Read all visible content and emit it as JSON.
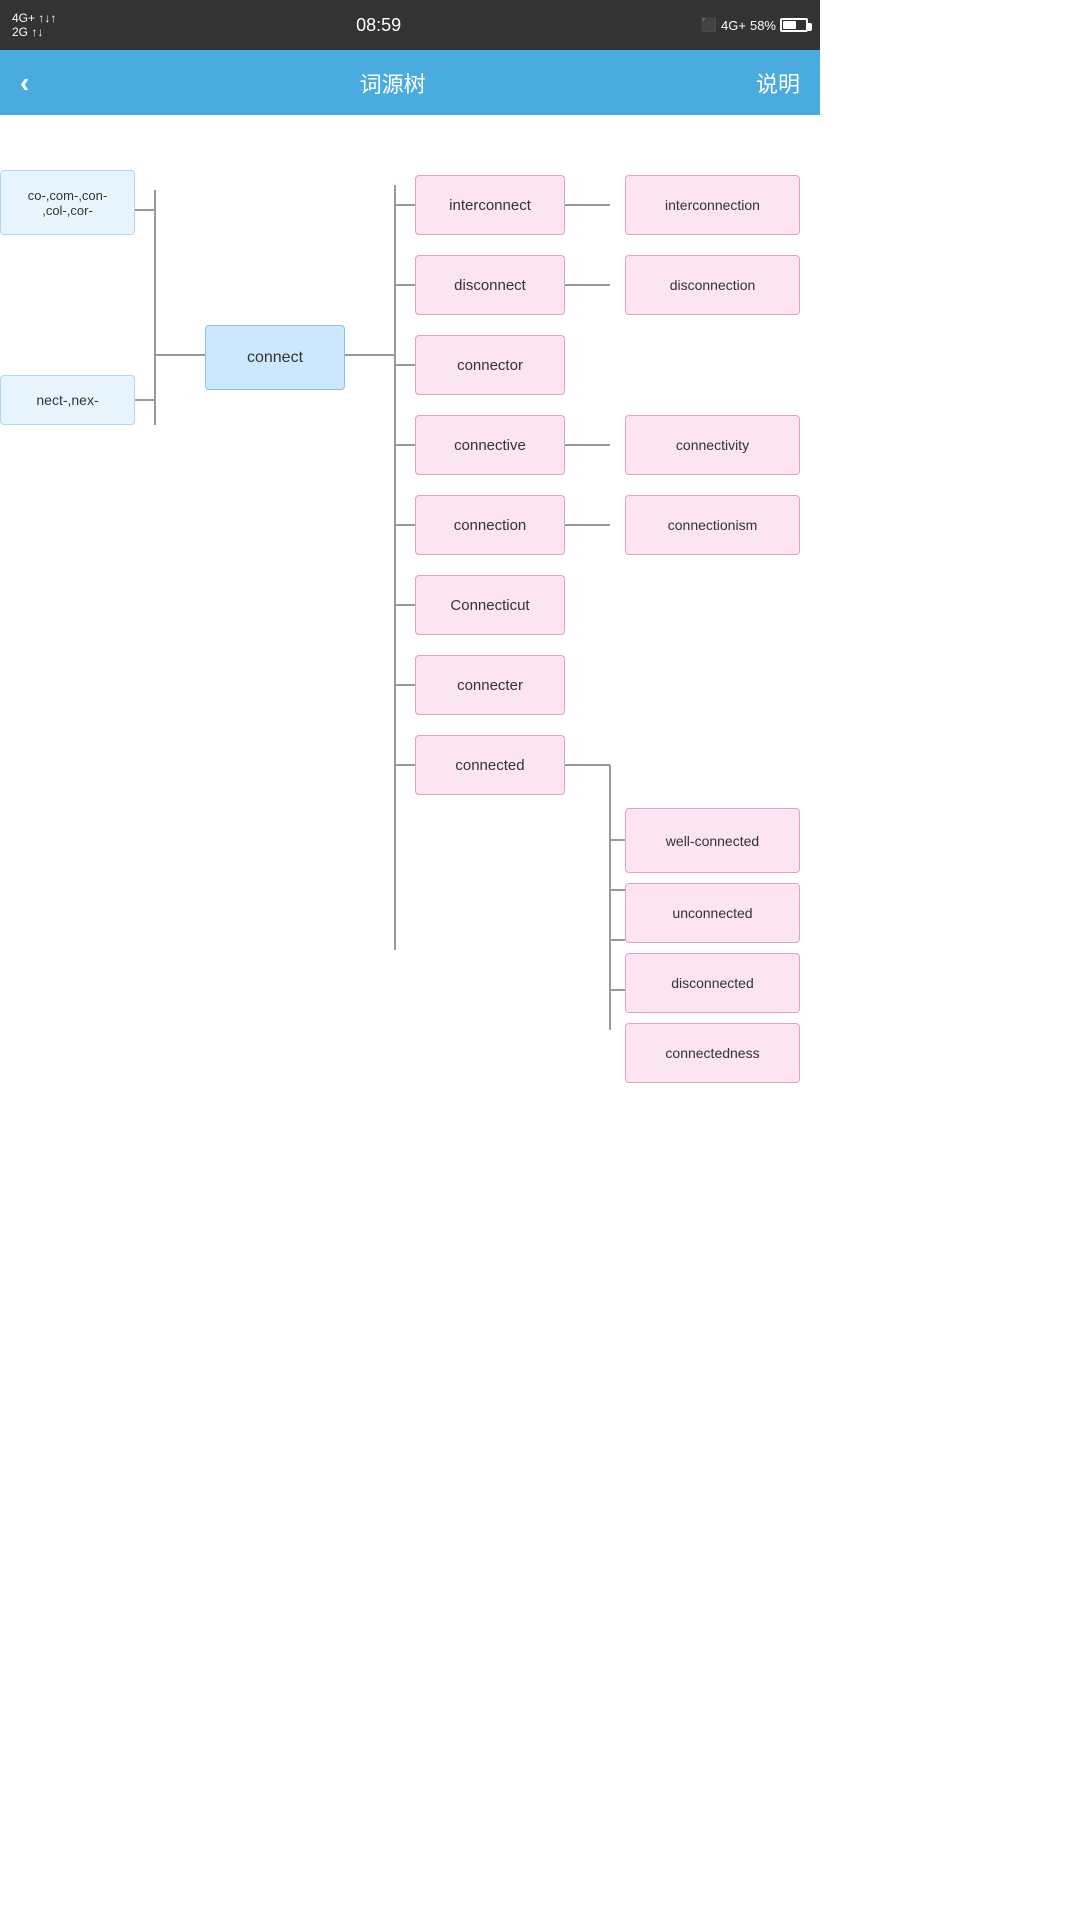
{
  "status_bar": {
    "network_left": "4G+ ↑↓↑",
    "network_left2": "2G ↑↓",
    "time": "08:59",
    "vibrate": "□",
    "network_right": "4G+",
    "battery_percent": "58%"
  },
  "header": {
    "back_label": "‹",
    "title": "词源树",
    "action": "说明"
  },
  "tree": {
    "prefix_nodes": [
      {
        "id": "prefix1",
        "label": "co-,com-,con-\n,col-,cor-"
      },
      {
        "id": "prefix2",
        "label": "nect-,nex-"
      }
    ],
    "root_node": {
      "id": "root",
      "label": "connect"
    },
    "level1_nodes": [
      {
        "id": "interconnect",
        "label": "interconnect"
      },
      {
        "id": "disconnect",
        "label": "disconnect"
      },
      {
        "id": "connector",
        "label": "connector"
      },
      {
        "id": "connective",
        "label": "connective"
      },
      {
        "id": "connection",
        "label": "connection"
      },
      {
        "id": "Connecticut",
        "label": "Connecticut"
      },
      {
        "id": "connecter",
        "label": "connecter"
      },
      {
        "id": "connected",
        "label": "connected"
      }
    ],
    "level2_nodes": [
      {
        "id": "interconnection",
        "label": "interconnection",
        "parent": "interconnect"
      },
      {
        "id": "disconnection",
        "label": "disconnection",
        "parent": "disconnect"
      },
      {
        "id": "connectivity",
        "label": "connectivity",
        "parent": "connective"
      },
      {
        "id": "connectionism",
        "label": "connectionism",
        "parent": "connection"
      },
      {
        "id": "well-connected",
        "label": "well-connected",
        "parent": "connected"
      },
      {
        "id": "unconnected",
        "label": "unconnected",
        "parent": "connected"
      },
      {
        "id": "disconnected",
        "label": "disconnected",
        "parent": "connected"
      },
      {
        "id": "connectedness",
        "label": "connectedness",
        "parent": "connected"
      }
    ]
  }
}
